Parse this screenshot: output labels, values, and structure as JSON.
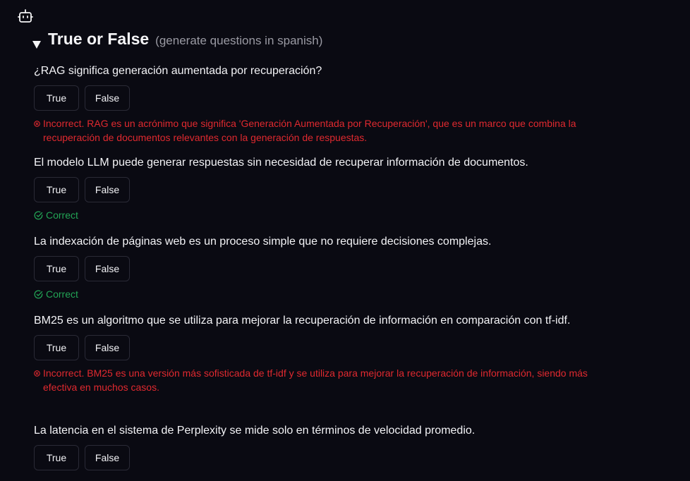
{
  "app": {
    "bot_icon": "bot-icon"
  },
  "section": {
    "collapse_icon": "triangle-down-icon",
    "title": "True or False",
    "subtitle": "(generate questions in spanish)"
  },
  "buttons": {
    "true_label": "True",
    "false_label": "False"
  },
  "questions": [
    {
      "text": "¿RAG significa generación aumentada por recuperación?",
      "status": "incorrect",
      "feedback": "Incorrect. RAG es un acrónimo que significa 'Generación Aumentada por Recuperación', que es un marco que combina la recuperación de documentos relevantes con la generación de respuestas."
    },
    {
      "text": "El modelo LLM puede generar respuestas sin necesidad de recuperar información de documentos.",
      "status": "correct",
      "feedback": "Correct"
    },
    {
      "text": "La indexación de páginas web es un proceso simple que no requiere decisiones complejas.",
      "status": "correct",
      "feedback": "Correct"
    },
    {
      "text": "BM25 es un algoritmo que se utiliza para mejorar la recuperación de información en comparación con tf-idf.",
      "status": "incorrect",
      "feedback": "Incorrect. BM25 es una versión más sofisticada de tf-idf y se utiliza para mejorar la recuperación de información, siendo más efectiva en muchos casos."
    },
    {
      "text": "La latencia en el sistema de Perplexity se mide solo en términos de velocidad promedio.",
      "status": "none",
      "feedback": ""
    }
  ],
  "colors": {
    "correct": "#22a455",
    "incorrect": "#e0292f",
    "background": "#0a0a12"
  }
}
